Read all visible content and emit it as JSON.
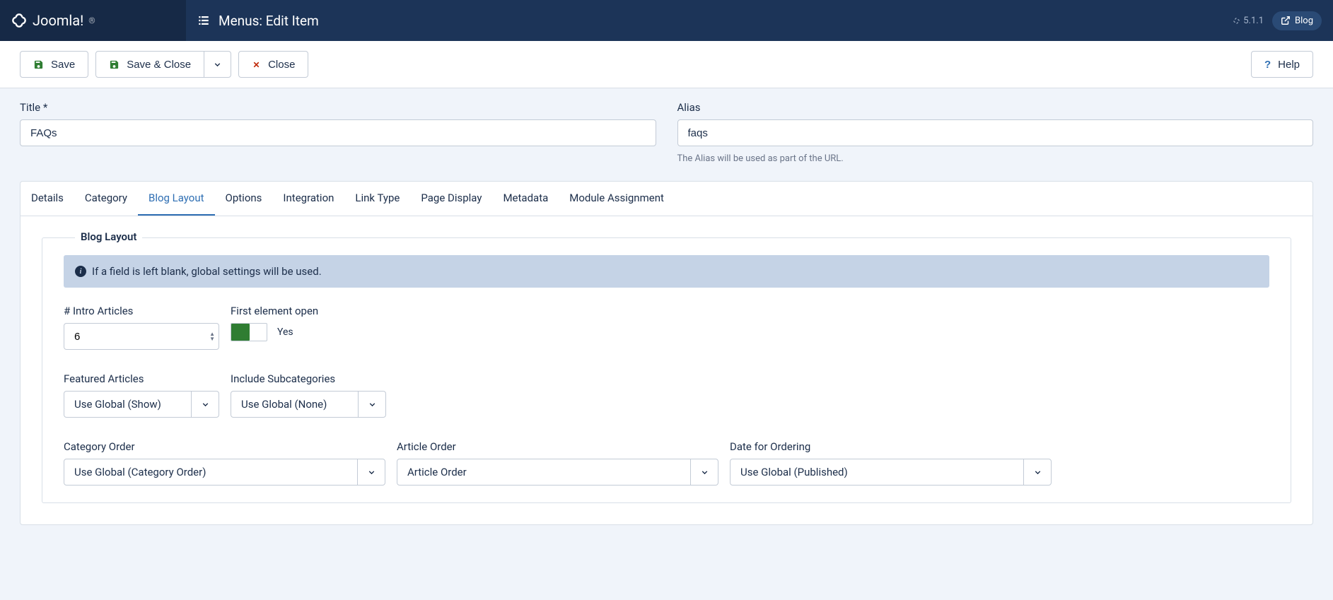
{
  "header": {
    "brand": "Joomla!",
    "pageTitle": "Menus: Edit Item",
    "version": "5.1.1",
    "siteLink": "Blog"
  },
  "toolbar": {
    "save": "Save",
    "saveClose": "Save & Close",
    "close": "Close",
    "help": "Help"
  },
  "fields": {
    "titleLabel": "Title *",
    "titleValue": "FAQs",
    "aliasLabel": "Alias",
    "aliasValue": "faqs",
    "aliasHelp": "The Alias will be used as part of the URL."
  },
  "tabs": [
    "Details",
    "Category",
    "Blog Layout",
    "Options",
    "Integration",
    "Link Type",
    "Page Display",
    "Metadata",
    "Module Assignment"
  ],
  "activeTab": "Blog Layout",
  "section": {
    "legend": "Blog Layout",
    "infoText": "If a field is left blank, global settings will be used.",
    "introArticlesLabel": "# Intro Articles",
    "introArticlesValue": "6",
    "firstElementOpenLabel": "First element open",
    "firstElementOpenValue": "Yes",
    "featuredArticlesLabel": "Featured Articles",
    "featuredArticlesValue": "Use Global (Show)",
    "includeSubcategoriesLabel": "Include Subcategories",
    "includeSubcategoriesValue": "Use Global (None)",
    "categoryOrderLabel": "Category Order",
    "categoryOrderValue": "Use Global (Category Order)",
    "articleOrderLabel": "Article Order",
    "articleOrderValue": "Article Order",
    "dateOrderingLabel": "Date for Ordering",
    "dateOrderingValue": "Use Global (Published)"
  }
}
